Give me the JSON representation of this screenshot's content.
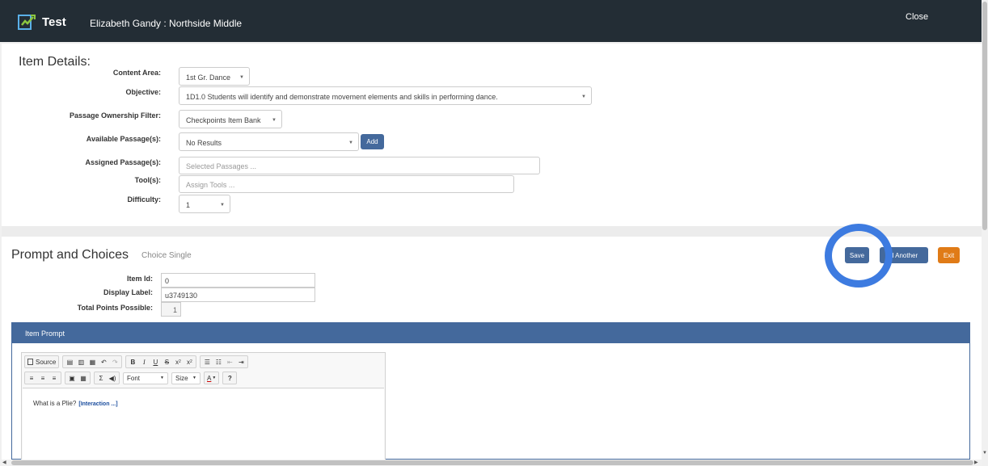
{
  "header": {
    "app_title": "Test",
    "user_school": "Elizabeth Gandy : Northside Middle",
    "close_label": "Close"
  },
  "item_details": {
    "title": "Item Details:",
    "content_area": {
      "label": "Content Area:",
      "value": "1st Gr. Dance"
    },
    "objective": {
      "label": "Objective:",
      "value": "1D1.0 Students will identify and demonstrate movement elements and skills in performing dance."
    },
    "passage_filter": {
      "label": "Passage Ownership Filter:",
      "value": "Checkpoints Item Bank"
    },
    "available_passages": {
      "label": "Available Passage(s):",
      "value": "No Results",
      "add_label": "Add"
    },
    "assigned_passages": {
      "label": "Assigned Passage(s):",
      "placeholder": "Selected Passages ..."
    },
    "tools": {
      "label": "Tool(s):",
      "placeholder": "Assign Tools ..."
    },
    "difficulty": {
      "label": "Difficulty:",
      "value": "1"
    }
  },
  "prompt_choices": {
    "title": "Prompt and Choices",
    "subtitle": "Choice Single",
    "save_label": "Save",
    "add_another_label": "d Another",
    "exit_label": "Exit",
    "item_id": {
      "label": "Item Id:",
      "value": "0"
    },
    "display_label": {
      "label": "Display Label:",
      "value": "u3749130"
    },
    "total_points": {
      "label": "Total Points Possible:",
      "value": "1"
    }
  },
  "item_prompt": {
    "title": "Item Prompt",
    "toolbar": {
      "source_label": "Source",
      "font_label": "Font",
      "size_label": "Size"
    },
    "content_text": "What is a Plie?",
    "interaction_label": "[Interaction ...]"
  },
  "colors": {
    "header_bg": "#232d35",
    "primary": "#44699c",
    "exit": "#e07b17",
    "highlight_ring": "#3d7be0"
  }
}
